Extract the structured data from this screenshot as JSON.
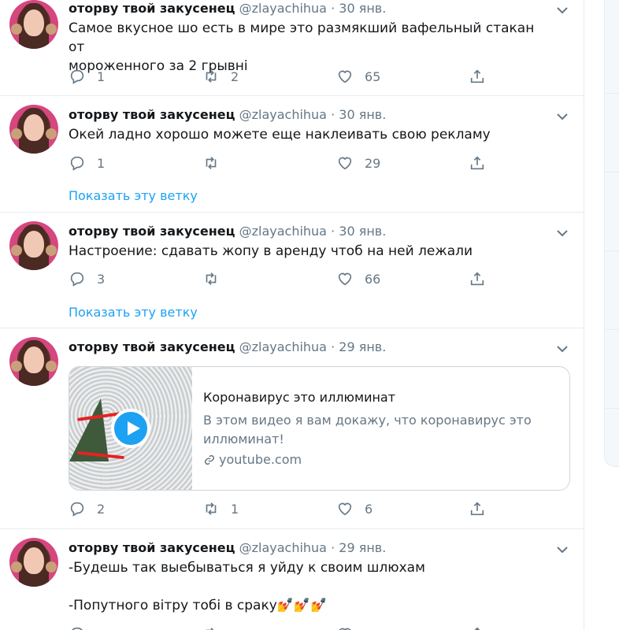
{
  "author": {
    "name": "оторву твой закусенец",
    "handle": "@zlayachihua",
    "dot": "·"
  },
  "show_thread_label": "Показать эту ветку",
  "tweets": [
    {
      "date": "30 янв.",
      "text": "Самое вкусное шо есть в мире это размякший вафельный стакан от\nмороженного за 2 грывні",
      "replies": "1",
      "retweets": "2",
      "likes": "65"
    },
    {
      "date": "30 янв.",
      "text": "Окей ладно хорошо можете еще наклеивать свою рекламу",
      "replies": "1",
      "retweets": "",
      "likes": "29"
    },
    {
      "date": "30 янв.",
      "text": "Настроение: сдавать жопу в аренду чтоб на ней лежали",
      "replies": "3",
      "retweets": "",
      "likes": "66"
    },
    {
      "date": "29 янв.",
      "text": "",
      "replies": "2",
      "retweets": "1",
      "likes": "6",
      "card": {
        "title": "Коронавирус это иллюминат",
        "description": "В этом видео я вам докажу, что коронавирус это иллюминат!",
        "domain": "youtube.com"
      }
    },
    {
      "date": "29 янв.",
      "text": "-Будешь так выебываться я уйду к своим шлюхам\n\n-Попутного вітру тобі в сраку💅💅💅",
      "replies": "",
      "retweets": "",
      "likes": ""
    }
  ],
  "icons": {
    "reply": "reply-icon",
    "retweet": "retweet-icon",
    "like": "heart-icon",
    "share": "share-icon",
    "menu": "chevron-down-icon"
  },
  "colors": {
    "accent": "#1da1f2",
    "muted": "#657786",
    "text": "#14171a",
    "border": "#e6ecf0"
  }
}
